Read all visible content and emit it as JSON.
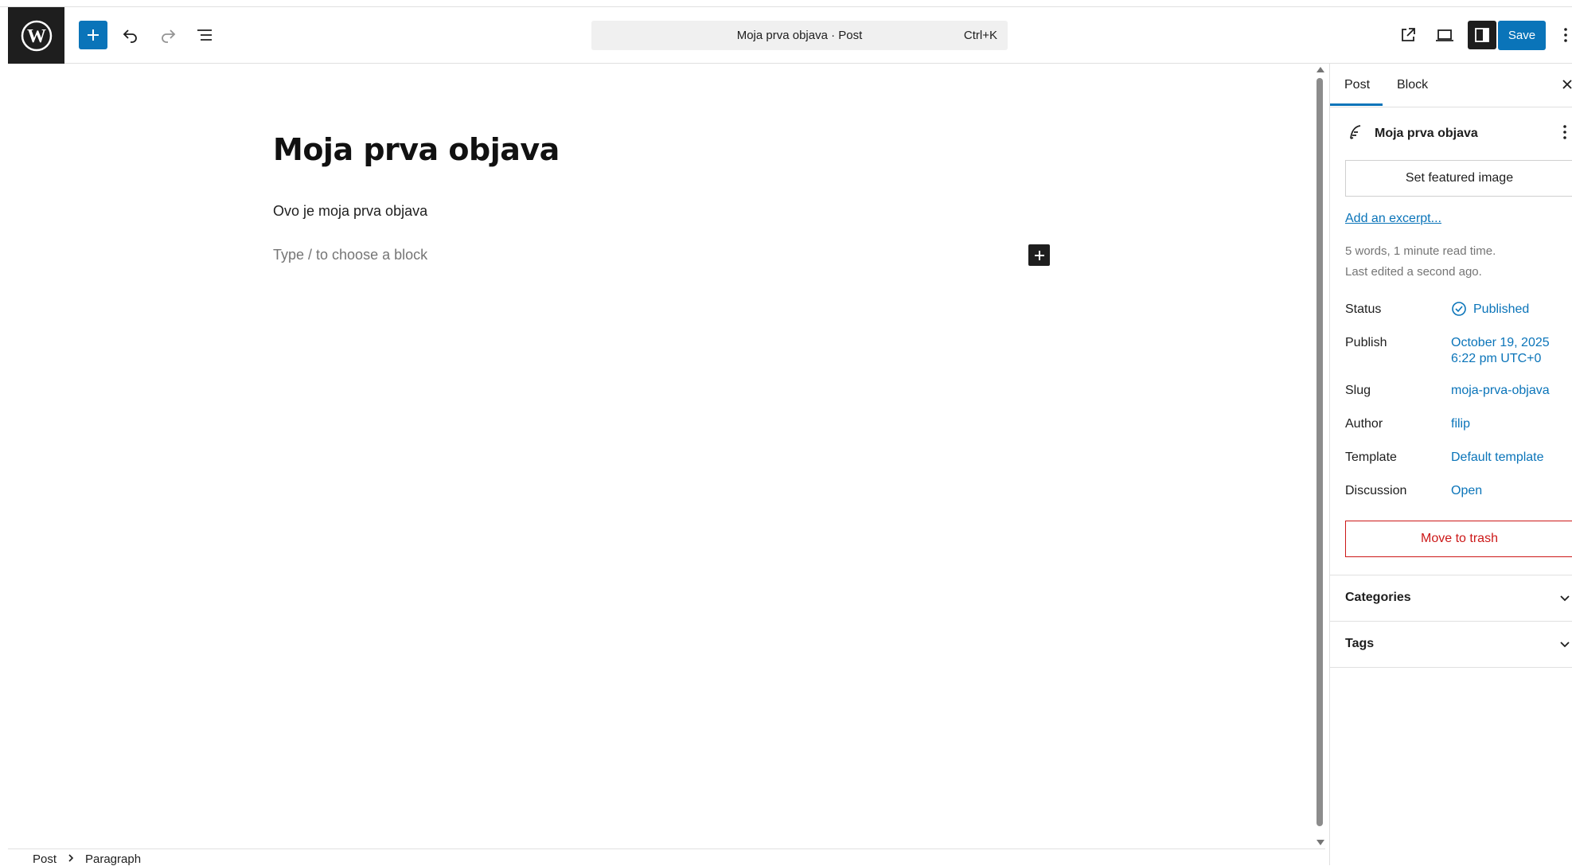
{
  "header": {
    "command_bar": {
      "title": "Moja prva objava · Post",
      "shortcut": "Ctrl+K"
    },
    "save_label": "Save"
  },
  "editor": {
    "title": "Moja prva objava",
    "paragraph": "Ovo je moja prva objava",
    "placeholder": "Type / to choose a block"
  },
  "footer": {
    "breadcrumb": [
      "Post",
      "Paragraph"
    ]
  },
  "sidebar": {
    "tabs": [
      "Post",
      "Block"
    ],
    "active_tab": "Post",
    "post_title": "Moja prva objava",
    "featured_image_label": "Set featured image",
    "excerpt_link": "Add an excerpt...",
    "meta_words": "5 words, 1 minute read time.",
    "meta_edited": "Last edited a second ago.",
    "rows": {
      "status": {
        "label": "Status",
        "value": "Published"
      },
      "publish": {
        "label": "Publish",
        "value_line1": "October 19, 2025",
        "value_line2": "6:22 pm UTC+0"
      },
      "slug": {
        "label": "Slug",
        "value": "moja-prva-objava"
      },
      "author": {
        "label": "Author",
        "value": "filip"
      },
      "template": {
        "label": "Template",
        "value": "Default template"
      },
      "discussion": {
        "label": "Discussion",
        "value": "Open"
      }
    },
    "trash_label": "Move to trash",
    "panels": [
      "Categories",
      "Tags"
    ]
  },
  "colors": {
    "accent": "#0a74b9",
    "danger": "#cc1818",
    "dark": "#1e1e1e"
  }
}
